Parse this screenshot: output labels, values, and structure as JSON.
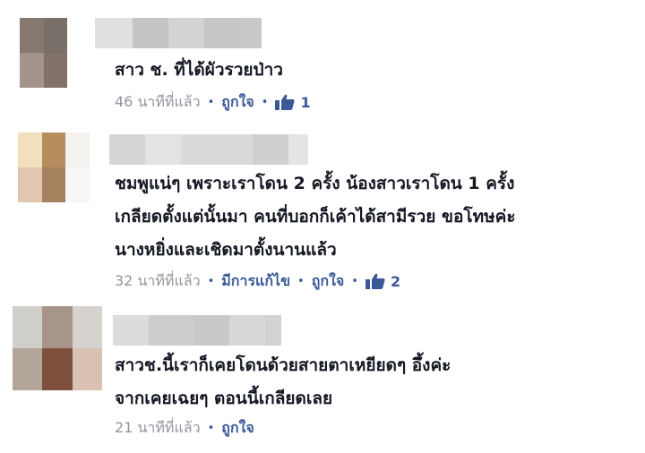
{
  "comments": [
    {
      "avatar_colors": [
        "#86786e",
        "#797069",
        "#ffffff",
        "#a2938b",
        "#807169",
        "#ffffff"
      ],
      "name_blur_colors": [
        "#e0e0e0",
        "#c5c5c5",
        "#d3d3d3",
        "#c7c7c7",
        "#c9c9c9"
      ],
      "text_lines": [
        "สาว ช. ที่ได้ผัวรวยป่าว"
      ],
      "time": "46 นาทีที่แล้ว",
      "edited": "",
      "like_label": "ถูกใจ",
      "like_count": "1"
    },
    {
      "avatar_colors": [
        "#f1dfbe",
        "#b68e5e",
        "#f3f2ee",
        "#e1c7b0",
        "#a6825f",
        "#f6f6f4"
      ],
      "name_blur_colors": [
        "#d6d6d6",
        "#e3e3e3",
        "#dadada",
        "#cfcfcf",
        "#e4e4e4"
      ],
      "text_lines": [
        "ชมพูแน่ๆ เพราะเราโดน 2 ครั้ง น้องสาวเราโดน 1 ครั้ง",
        "เกลียดตั้งแต่นั้นมา คนที่บอกก็เค้าได้สามีรวย ขอโทษค่ะ",
        "นางหยิ่งและเชิดมาตั้งนานแล้ว"
      ],
      "time": "32 นาทีที่แล้ว",
      "edited": "มีการแก้ไข",
      "like_label": "ถูกใจ",
      "like_count": "2"
    },
    {
      "avatar_colors": [
        "#d0cecb",
        "#a89589",
        "#d6d2cd",
        "#b2a69b",
        "#7d513d",
        "#d9c2b3"
      ],
      "name_blur_colors": [
        "#dcdcdc",
        "#cdcdcd",
        "#c9c9c9",
        "#d8d8d8",
        "#d2d2d2"
      ],
      "text_lines": [
        "สาวช.นี้เราก็เคยโดนด้วยสายตาเหยียดๆ อึ้งค่ะ",
        "จากเคยเฉยๆ ตอนนี้เกลียดเลย"
      ],
      "time": "21 นาทีที่แล้ว",
      "edited": "",
      "like_label": "ถูกใจ",
      "like_count": ""
    }
  ],
  "colors": {
    "link": "#3b5998",
    "meta": "#90949c",
    "text": "#141823"
  },
  "icons": {
    "like": "thumbs-up-icon"
  }
}
